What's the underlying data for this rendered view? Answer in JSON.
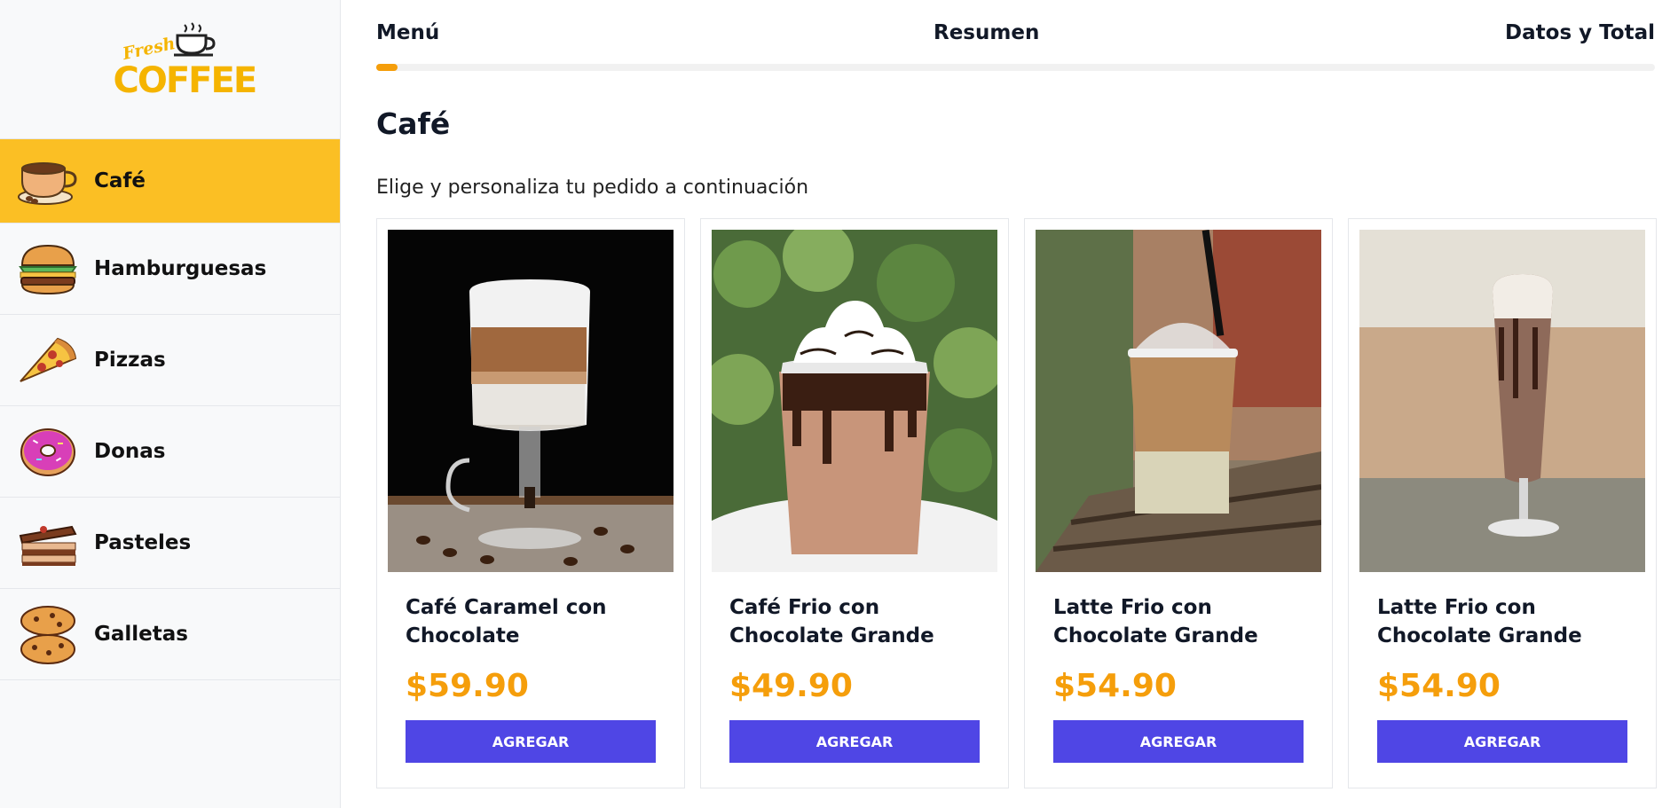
{
  "brand": {
    "logo_line1": "Fresh",
    "logo_line2": "COFFEE"
  },
  "categories": [
    {
      "label": "Café",
      "icon": "coffee-cup-icon",
      "active": true
    },
    {
      "label": "Hamburguesas",
      "icon": "burger-icon",
      "active": false
    },
    {
      "label": "Pizzas",
      "icon": "pizza-icon",
      "active": false
    },
    {
      "label": "Donas",
      "icon": "donut-icon",
      "active": false
    },
    {
      "label": "Pasteles",
      "icon": "cake-icon",
      "active": false
    },
    {
      "label": "Galletas",
      "icon": "cookie-icon",
      "active": false
    }
  ],
  "steps": {
    "menu": "Menú",
    "resumen": "Resumen",
    "total": "Datos y Total",
    "progress": 0.017
  },
  "page": {
    "title": "Café",
    "subtitle": "Elige y personaliza tu pedido a continuación"
  },
  "products": [
    {
      "name": "Café Caramel con Chocolate",
      "price": "$59.90",
      "button": "AGREGAR"
    },
    {
      "name": "Café Frio con Chocolate Grande",
      "price": "$49.90",
      "button": "AGREGAR"
    },
    {
      "name": "Latte Frio con Chocolate Grande",
      "price": "$54.90",
      "button": "AGREGAR"
    },
    {
      "name": "Latte Frio con Chocolate Grande",
      "price": "$54.90",
      "button": "AGREGAR"
    }
  ],
  "colors": {
    "accent": "#fbbf24",
    "price": "#f59e0b",
    "button": "#4f46e5"
  }
}
